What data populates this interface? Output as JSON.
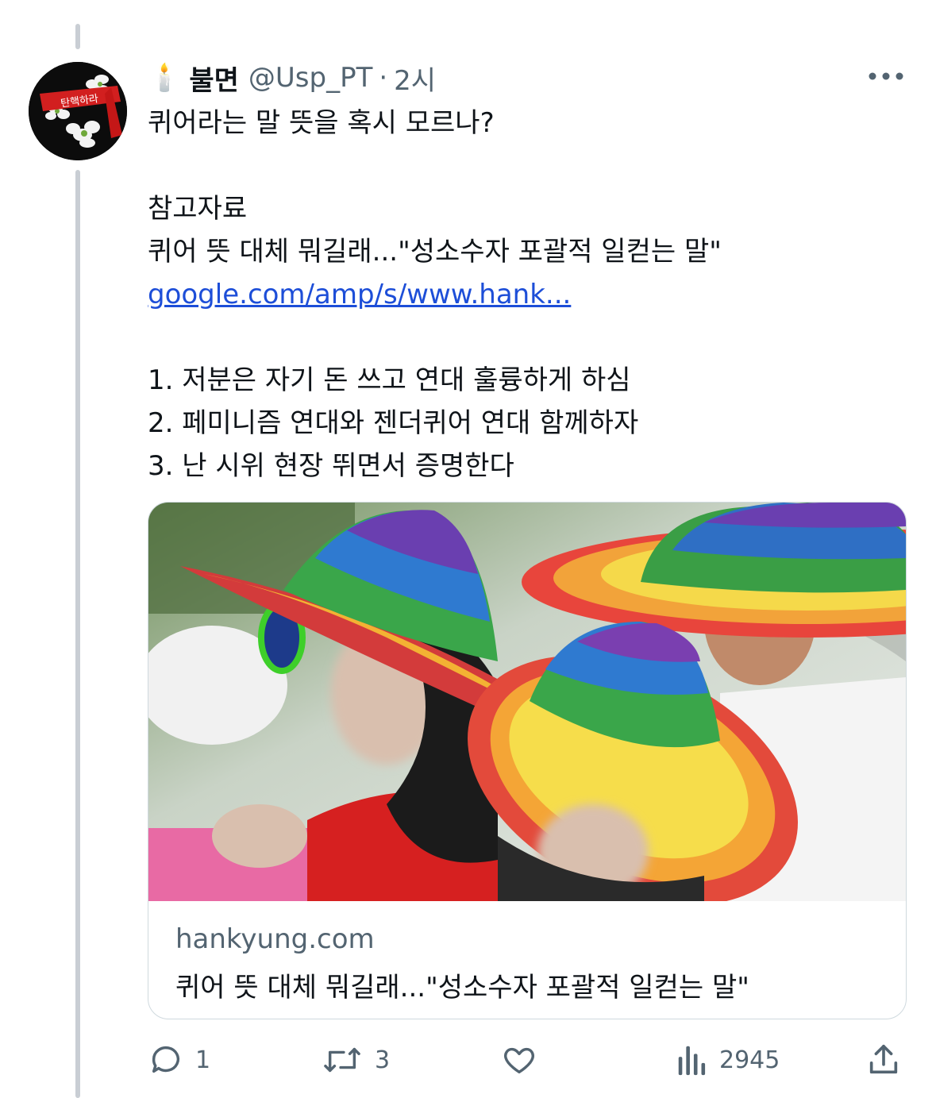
{
  "tweet": {
    "display_name": "불면",
    "candle_emoji": "🕯️",
    "handle": "@Usp_PT",
    "separator": "·",
    "time": "2시",
    "avatar_banner_text": "탄핵하라",
    "lines": {
      "l1": "퀴어라는 말 뜻을 혹시 모르나?",
      "l2": "참고자료",
      "l3": "퀴어 뜻 대체 뭐길래...\"성소수자 포괄적 일컫는 말\"",
      "l4_link": "google.com/amp/s/www.hank...",
      "l5": "1. 저분은 자기 돈 쓰고 연대 훌륭하게 하심",
      "l6": "2. 페미니즘 연대와 젠더퀴어 연대 함께하자",
      "l7": "3. 난 시위 현장 뛰면서 증명한다"
    }
  },
  "card": {
    "domain": "hankyung.com",
    "title": "퀴어 뜻 대체 뭐길래...\"성소수자 포괄적 일컫는 말\""
  },
  "actions": {
    "reply_count": "1",
    "retweet_count": "3",
    "views_count": "2945"
  },
  "icons": [
    "more-icon",
    "reply-icon",
    "retweet-icon",
    "like-icon",
    "views-icon",
    "share-icon"
  ],
  "colors": {
    "link": "#1d4ed8",
    "muted": "#536471",
    "text": "#0f1419",
    "thread_line": "#c9ced4"
  }
}
